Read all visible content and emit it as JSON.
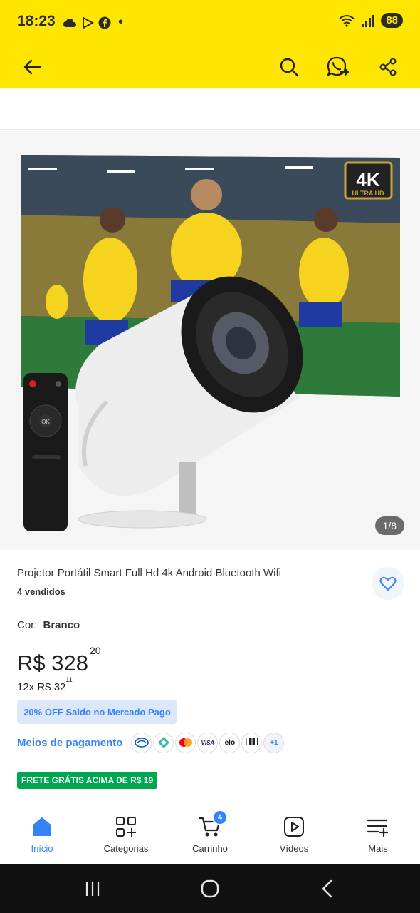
{
  "status": {
    "time": "18:23",
    "battery": "88"
  },
  "appbar": {
    "back_icon": "arrow-left-icon",
    "search_icon": "search-icon",
    "whatsapp_icon": "whatsapp-share-icon",
    "share_icon": "share-icon"
  },
  "gallery": {
    "counter": "1/8"
  },
  "product": {
    "title": "Projetor Portátil Smart Full Hd 4k Android Bluetooth Wifi",
    "sold": "4 vendidos",
    "color_label": "Cor:",
    "color_value": "Branco",
    "price_main": "R$ 328",
    "price_cents": "20",
    "installments_prefix": "12x R$ 32",
    "installments_cents": "11",
    "promo": "20% OFF Saldo no Mercado Pago",
    "payment_link": "Meios de pagamento",
    "payment_more": "+1",
    "shipping": "FRETE GRÁTIS ACIMA DE R$ 19"
  },
  "tabs": [
    {
      "label": "Início",
      "icon": "home-icon"
    },
    {
      "label": "Categorias",
      "icon": "categories-icon"
    },
    {
      "label": "Carrinho",
      "icon": "cart-icon",
      "badge": "4"
    },
    {
      "label": "Vídeos",
      "icon": "play-icon"
    },
    {
      "label": "Mais",
      "icon": "more-list-icon"
    }
  ],
  "colors": {
    "brand_yellow": "#ffe600",
    "accent_blue": "#3483fa",
    "shipping_green": "#00a650"
  }
}
